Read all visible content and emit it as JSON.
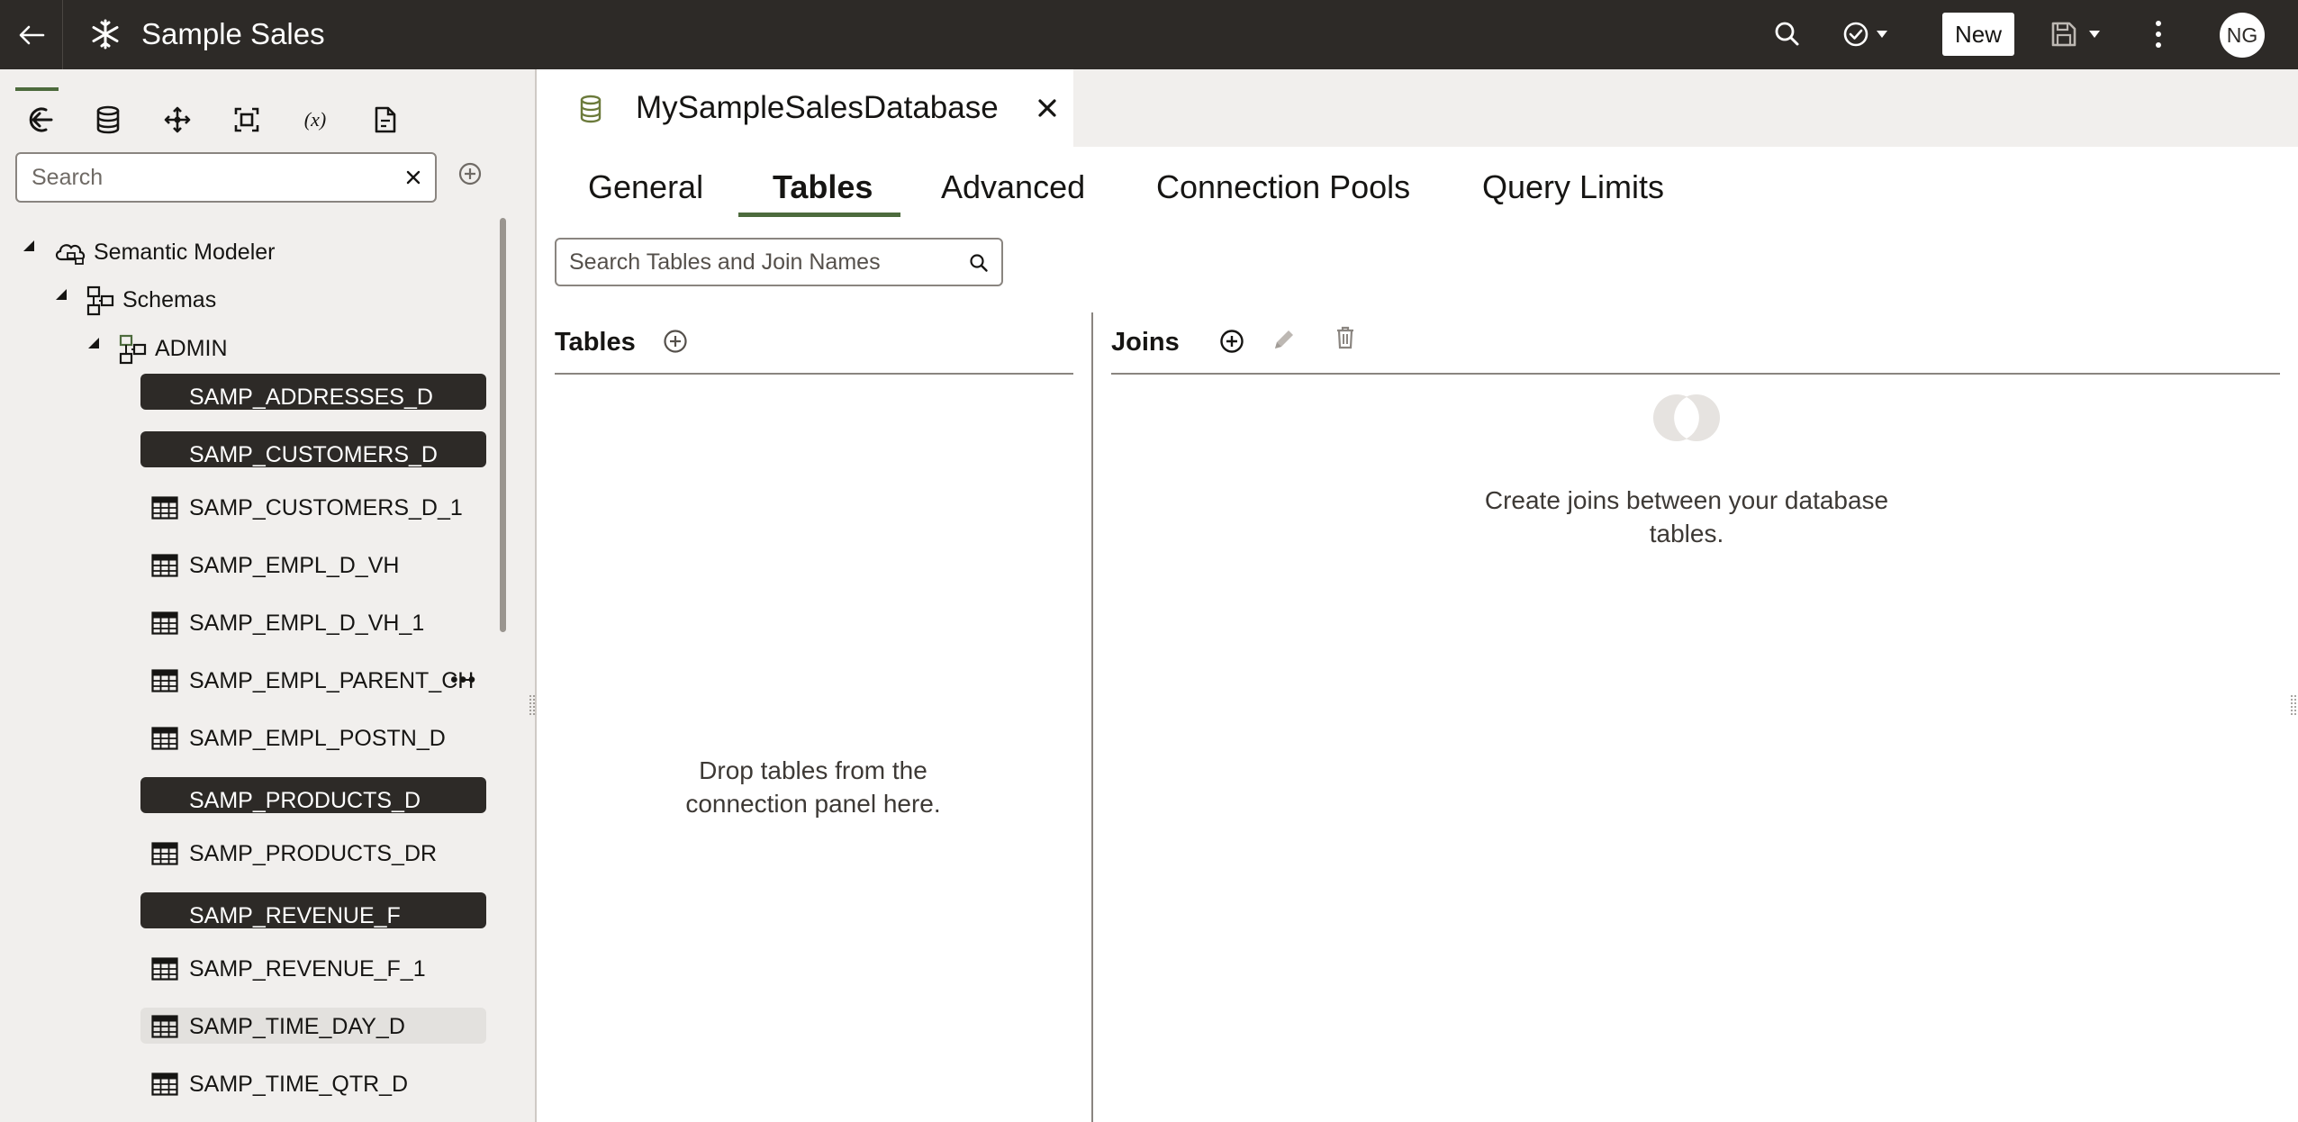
{
  "topbar": {
    "back_icon": "arrow-left-icon",
    "app_icon": "snowflake-icon",
    "title": "Sample Sales",
    "search_icon": "search-icon",
    "check_icon": "check-circle-icon",
    "new_label": "New",
    "save_icon": "save-icon",
    "more_icon": "kebab-menu-icon",
    "avatar_initials": "NG"
  },
  "left_panel": {
    "tabs": [
      {
        "icon": "connections-icon",
        "active": true
      },
      {
        "icon": "database-icon",
        "active": false
      },
      {
        "icon": "move-arrows-icon",
        "active": false
      },
      {
        "icon": "frame-icon",
        "active": false
      },
      {
        "icon": "variable-icon",
        "label": "(x)",
        "active": false
      },
      {
        "icon": "document-icon",
        "active": false
      }
    ],
    "search_placeholder": "Search",
    "tree": {
      "root": "Semantic Modeler",
      "schemas": "Schemas",
      "schema": "ADMIN",
      "tables": [
        {
          "name": "SAMP_ADDRESSES_D",
          "state": "selected"
        },
        {
          "name": "SAMP_CUSTOMERS_D",
          "state": "selected"
        },
        {
          "name": "SAMP_CUSTOMERS_D_1",
          "state": "normal"
        },
        {
          "name": "SAMP_EMPL_D_VH",
          "state": "normal"
        },
        {
          "name": "SAMP_EMPL_D_VH_1",
          "state": "normal"
        },
        {
          "name": "SAMP_EMPL_PARENT_CH",
          "state": "normal",
          "overflow": "•••"
        },
        {
          "name": "SAMP_EMPL_POSTN_D",
          "state": "normal"
        },
        {
          "name": "SAMP_PRODUCTS_D",
          "state": "selected"
        },
        {
          "name": "SAMP_PRODUCTS_DR",
          "state": "normal"
        },
        {
          "name": "SAMP_REVENUE_F",
          "state": "selected"
        },
        {
          "name": "SAMP_REVENUE_F_1",
          "state": "normal"
        },
        {
          "name": "SAMP_TIME_DAY_D",
          "state": "hover"
        },
        {
          "name": "SAMP_TIME_QTR_D",
          "state": "normal"
        }
      ]
    }
  },
  "editor": {
    "doc_tab": {
      "icon": "database-icon",
      "label": "MySampleSalesDatabase"
    },
    "tabs": [
      {
        "label": "General",
        "active": false
      },
      {
        "label": "Tables",
        "active": true
      },
      {
        "label": "Advanced",
        "active": false
      },
      {
        "label": "Connection Pools",
        "active": false
      },
      {
        "label": "Query Limits",
        "active": false
      }
    ],
    "search_placeholder": "Search Tables and Join Names",
    "tables_section": {
      "title": "Tables",
      "empty_text": "Drop tables from the connection panel here."
    },
    "joins_section": {
      "title": "Joins",
      "empty_text": "Create joins between your database tables."
    }
  },
  "colors": {
    "topbar": "#2d2a27",
    "accent": "#4d6b3d",
    "panel": "#f1efed",
    "selected": "#2d2a27"
  }
}
